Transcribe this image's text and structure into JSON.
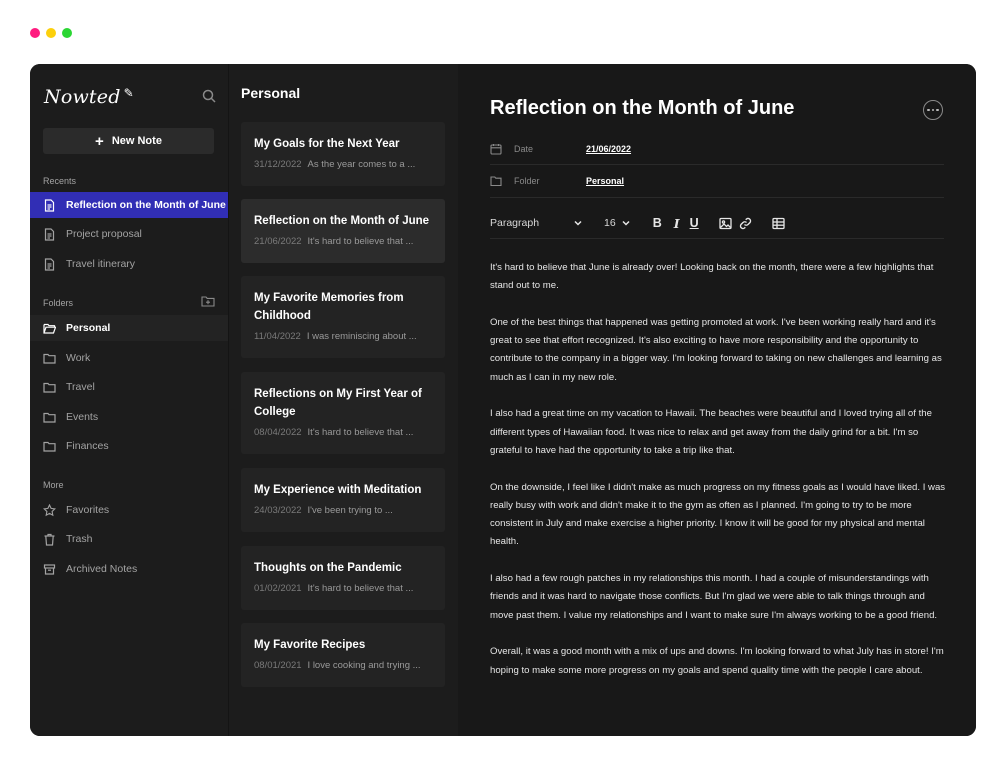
{
  "window": {
    "dot_colors": [
      "#ff1b7f",
      "#fcd00c",
      "#2bd633"
    ]
  },
  "sidebar": {
    "logo": "Nowted",
    "new_note_label": "New Note",
    "recents_label": "Recents",
    "recents": [
      {
        "label": "Reflection on the Month of June",
        "active": true
      },
      {
        "label": "Project proposal",
        "active": false
      },
      {
        "label": "Travel itinerary",
        "active": false
      }
    ],
    "folders_label": "Folders",
    "folders": [
      {
        "label": "Personal",
        "active": true
      },
      {
        "label": "Work",
        "active": false
      },
      {
        "label": "Travel",
        "active": false
      },
      {
        "label": "Events",
        "active": false
      },
      {
        "label": "Finances",
        "active": false
      }
    ],
    "more_label": "More",
    "more": [
      {
        "label": "Favorites",
        "icon": "star-icon"
      },
      {
        "label": "Trash",
        "icon": "trash-icon"
      },
      {
        "label": "Archived Notes",
        "icon": "archive-icon"
      }
    ]
  },
  "note_list": {
    "title": "Personal",
    "notes": [
      {
        "title": "My Goals for the Next Year",
        "date": "31/12/2022",
        "snippet": "As the year comes to a ..."
      },
      {
        "title": "Reflection on the Month of June",
        "date": "21/06/2022",
        "snippet": "It's hard to believe that ..."
      },
      {
        "title": "My Favorite Memories from Childhood",
        "date": "11/04/2022",
        "snippet": "I was reminiscing about ..."
      },
      {
        "title": "Reflections on My First Year of College",
        "date": "08/04/2022",
        "snippet": "It's hard to believe that ..."
      },
      {
        "title": "My Experience with Meditation",
        "date": "24/03/2022",
        "snippet": "I've been trying to ..."
      },
      {
        "title": "Thoughts on the Pandemic",
        "date": "01/02/2021",
        "snippet": "It's hard to believe that ..."
      },
      {
        "title": "My Favorite Recipes",
        "date": "08/01/2021",
        "snippet": "I love cooking and trying ..."
      }
    ]
  },
  "editor": {
    "title": "Reflection on the Month of June",
    "date_label": "Date",
    "date_value": "21/06/2022",
    "folder_label": "Folder",
    "folder_value": "Personal",
    "toolbar": {
      "paragraph": "Paragraph",
      "font_size": "16",
      "bold": "B",
      "italic": "I",
      "underline": "U"
    },
    "paragraphs": [
      "It's hard to believe that June is already over! Looking back on the month, there were a few highlights that stand out to me.",
      "One of the best things that happened was getting promoted at work. I've been working really hard and it's great to see that effort recognized. It's also exciting to have more responsibility and the opportunity to contribute to the company in a bigger way. I'm looking forward to taking on new challenges and learning as much as I can in my new role.",
      "I also had a great time on my vacation to Hawaii. The beaches were beautiful and I loved trying all of the different types of Hawaiian food. It was nice to relax and get away from the daily grind for a bit. I'm so grateful to have had the opportunity to take a trip like that.",
      "On the downside, I feel like I didn't make as much progress on my fitness goals as I would have liked. I was really busy with work and didn't make it to the gym as often as I planned. I'm going to try to be more consistent in July and make exercise a higher priority. I know it will be good for my physical and mental health.",
      "I also had a few rough patches in my relationships this month. I had a couple of misunderstandings with friends and it was hard to navigate those conflicts. But I'm glad we were able to talk things through and move past them. I value my relationships and I want to make sure I'm always working to be a good friend.",
      "Overall, it was a good month with a mix of ups and downs. I'm looking forward to what July has in store! I'm hoping to make some more progress on my goals and spend quality time with the people I care about."
    ]
  }
}
